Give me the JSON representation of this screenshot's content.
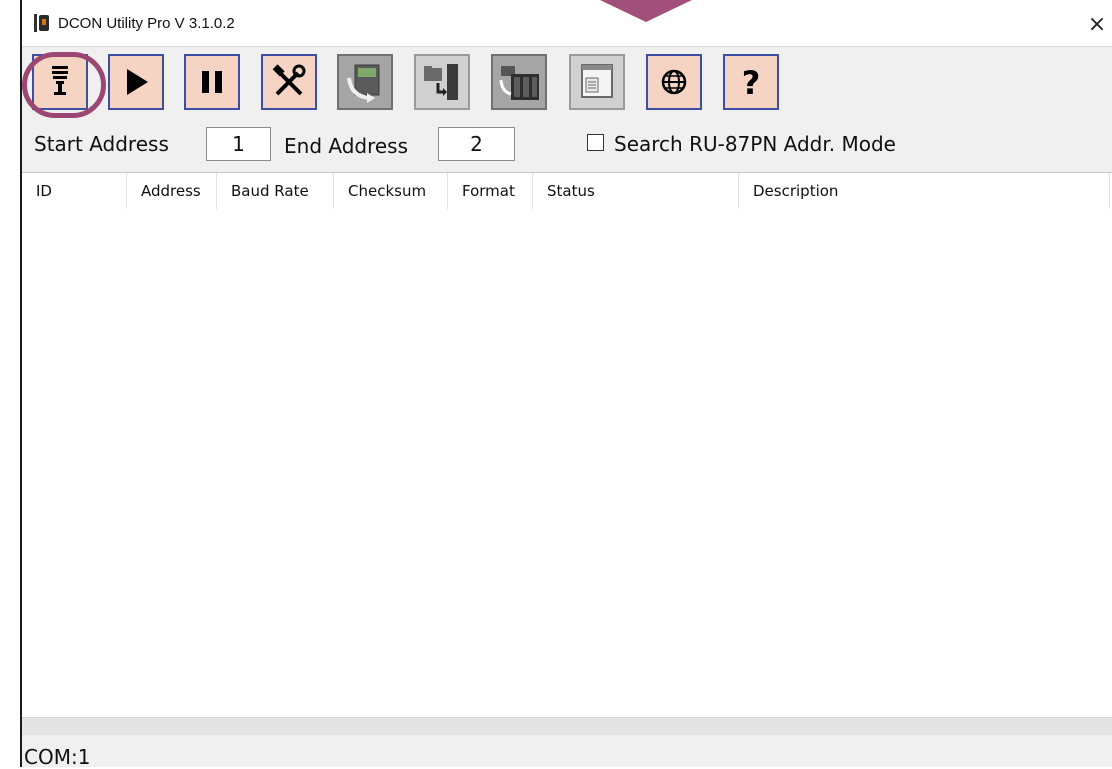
{
  "window": {
    "title": "DCON Utility Pro V 3.1.0.2",
    "close_glyph": "×"
  },
  "toolbar": {
    "buttons": [
      {
        "name": "com-port-settings-button",
        "icon": "com-port-plug-icon",
        "style": "peach",
        "highlighted": true
      },
      {
        "name": "start-search-button",
        "icon": "play-icon",
        "glyph": "▶",
        "style": "peach"
      },
      {
        "name": "stop-search-button",
        "icon": "pause-icon",
        "glyph": "❚❚",
        "style": "peach"
      },
      {
        "name": "settings-button",
        "icon": "tools-icon",
        "glyph": "⚒",
        "style": "peach"
      },
      {
        "name": "firmware-update-button",
        "icon": "module-refresh-icon",
        "style": "gray"
      },
      {
        "name": "load-file-button",
        "icon": "folder-module-icon",
        "style": "gray2"
      },
      {
        "name": "terminal-module-button",
        "icon": "rack-module-icon",
        "style": "gray"
      },
      {
        "name": "dat-window-button",
        "icon": "window-document-icon",
        "style": "gray2"
      },
      {
        "name": "language-button",
        "icon": "globe-icon",
        "glyph": "🌐",
        "style": "peach"
      },
      {
        "name": "help-button",
        "icon": "question-icon",
        "glyph": "?",
        "style": "peach"
      }
    ],
    "highlight_color": "#9b4673"
  },
  "search": {
    "start_label": "Start Address",
    "start_value": "1",
    "end_label": "End Address",
    "end_value": "2",
    "mode_checkbox_label": "Search RU-87PN Addr. Mode",
    "mode_checked": false
  },
  "table": {
    "columns": [
      "ID",
      "Address",
      "Baud Rate",
      "Checksum",
      "Format",
      "Status",
      "Description"
    ],
    "rows": []
  },
  "status_bar": {
    "text": "COM:1"
  },
  "colors": {
    "button_face": "#f5d4c4",
    "button_border": "#3d4fa3",
    "annotation": "#a0507a"
  }
}
